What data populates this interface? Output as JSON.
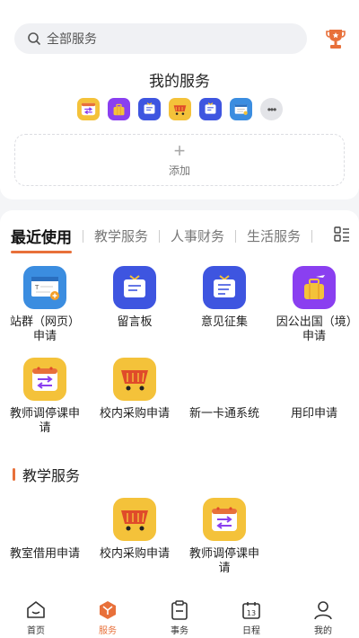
{
  "search": {
    "placeholder": "全部服务"
  },
  "my_services": {
    "title": "我的服务",
    "icons": [
      "course-change-icon",
      "abroad-icon",
      "feedback-icon",
      "purchase-icon",
      "survey-icon",
      "site-apply-icon"
    ],
    "more_icon": "more-icon"
  },
  "add": {
    "label": "添加"
  },
  "tabs": [
    {
      "label": "最近使用",
      "active": true
    },
    {
      "label": "教学服务"
    },
    {
      "label": "人事财务"
    },
    {
      "label": "生活服务"
    }
  ],
  "recent": [
    {
      "label": "站群（网页）申请",
      "icon": "site-apply-icon"
    },
    {
      "label": "留言板",
      "icon": "message-board-icon"
    },
    {
      "label": "意见征集",
      "icon": "survey-icon"
    },
    {
      "label": "因公出国（境）申请",
      "icon": "abroad-icon"
    },
    {
      "label": "教师调停课申请",
      "icon": "course-change-icon"
    },
    {
      "label": "校内采购申请",
      "icon": "purchase-icon"
    },
    {
      "label": "新一卡通系统",
      "icon": ""
    },
    {
      "label": "用印申请",
      "icon": ""
    }
  ],
  "teaching": {
    "title": "教学服务",
    "items": [
      {
        "label": "教室借用申请",
        "icon": ""
      },
      {
        "label": "校内采购申请",
        "icon": "purchase-icon"
      },
      {
        "label": "教师调停课申请",
        "icon": "course-change-icon"
      }
    ]
  },
  "nav": [
    {
      "label": "首页",
      "icon": "home-icon"
    },
    {
      "label": "服务",
      "icon": "service-icon",
      "active": true
    },
    {
      "label": "事务",
      "icon": "affairs-icon"
    },
    {
      "label": "日程",
      "icon": "calendar-icon"
    },
    {
      "label": "我的",
      "icon": "profile-icon"
    }
  ],
  "nav_calendar_day": "13",
  "colors": {
    "accent": "#e8703a",
    "purple": "#8a3ff0",
    "blue": "#3e55e0",
    "yellow": "#f4c23a"
  }
}
